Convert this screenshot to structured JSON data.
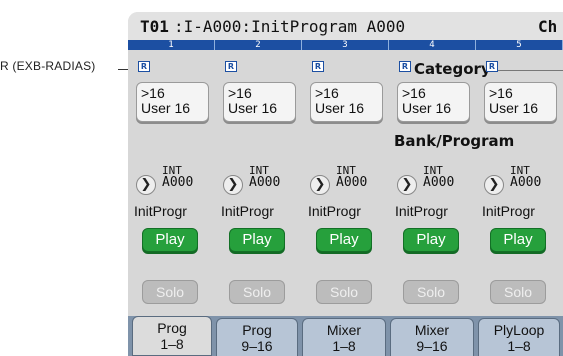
{
  "callout": {
    "label": "R (EXB-RADIAS)"
  },
  "title": {
    "number": "T01",
    "name": ":I-A000:InitProgram A000",
    "right": "Ch"
  },
  "track_numbers": [
    "1",
    "2",
    "3",
    "4",
    "5"
  ],
  "sections": {
    "category": "Category",
    "bank_program": "Bank/Program"
  },
  "columns": [
    {
      "r_icon": "R",
      "ch_line1": ">16",
      "ch_line2": "User 16",
      "bank": "INT",
      "prog": "A000",
      "name": "InitProgr",
      "play": "Play",
      "solo": "Solo"
    },
    {
      "r_icon": "R",
      "ch_line1": ">16",
      "ch_line2": "User 16",
      "bank": "INT",
      "prog": "A000",
      "name": "InitProgr",
      "play": "Play",
      "solo": "Solo"
    },
    {
      "r_icon": "R",
      "ch_line1": ">16",
      "ch_line2": "User 16",
      "bank": "INT",
      "prog": "A000",
      "name": "InitProgr",
      "play": "Play",
      "solo": "Solo"
    },
    {
      "r_icon": "R",
      "ch_line1": ">16",
      "ch_line2": "User 16",
      "bank": "INT",
      "prog": "A000",
      "name": "InitProgr",
      "play": "Play",
      "solo": "Solo"
    },
    {
      "r_icon": "R",
      "ch_line1": ">16",
      "ch_line2": "User 16",
      "bank": "INT",
      "prog": "A000",
      "name": "InitProgr",
      "play": "Play",
      "solo": "Solo"
    }
  ],
  "tabs": [
    {
      "line1": "Prog",
      "line2": "1–8",
      "active": true
    },
    {
      "line1": "Prog",
      "line2": "9–16",
      "active": false
    },
    {
      "line1": "Mixer",
      "line2": "1–8",
      "active": false
    },
    {
      "line1": "Mixer",
      "line2": "9–16",
      "active": false
    },
    {
      "line1": "PlyLoop",
      "line2": "1–8",
      "active": false
    }
  ],
  "colors": {
    "accent": "#1c4fa2",
    "play": "#26a03c",
    "tabbar": "#7f93aa"
  }
}
